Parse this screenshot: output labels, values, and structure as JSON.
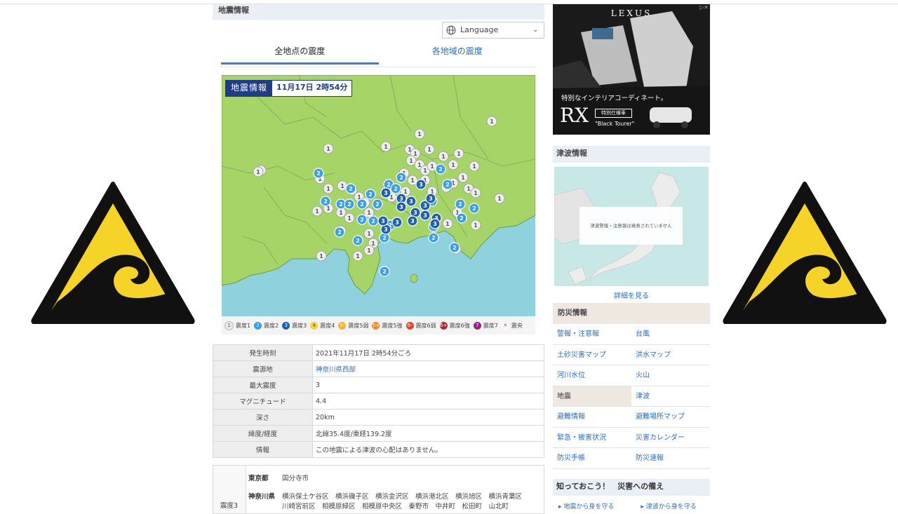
{
  "section_title": "地震情報",
  "language_label": "Language",
  "tabs": [
    "全地点の震度",
    "各地域の震度"
  ],
  "map": {
    "badge_label": "地震情報",
    "badge_datetime": "11月17日 2時54分"
  },
  "legend": [
    {
      "mark": "1",
      "label": "震度1",
      "color": "#e8e8e8",
      "text_color": "#555"
    },
    {
      "mark": "2",
      "label": "震度2",
      "color": "#3a9ee8",
      "text_color": "#fff"
    },
    {
      "mark": "3",
      "label": "震度3",
      "color": "#1f5fb0",
      "text_color": "#fff"
    },
    {
      "mark": "4",
      "label": "震度4",
      "color": "#f3d33a",
      "text_color": "#555"
    },
    {
      "mark": "5-",
      "label": "震度5弱",
      "color": "#f4b23a",
      "text_color": "#fff"
    },
    {
      "mark": "5+",
      "label": "震度5強",
      "color": "#f08a2a",
      "text_color": "#fff"
    },
    {
      "mark": "6-",
      "label": "震度6弱",
      "color": "#e2452f",
      "text_color": "#fff"
    },
    {
      "mark": "6+",
      "label": "震度6強",
      "color": "#b52034",
      "text_color": "#fff"
    },
    {
      "mark": "7",
      "label": "震度7",
      "color": "#9a1f86",
      "text_color": "#fff"
    },
    {
      "mark": "✕",
      "label": "震央",
      "color": "#ffffff",
      "text_color": "#d33"
    }
  ],
  "details": [
    {
      "key": "発生時刻",
      "value": "2021年11月17日 2時54分ごろ",
      "link": false
    },
    {
      "key": "震源地",
      "value": "神奈川県西部",
      "link": true
    },
    {
      "key": "最大震度",
      "value": "3",
      "link": false
    },
    {
      "key": "マグニチュード",
      "value": "4.4",
      "link": false
    },
    {
      "key": "深さ",
      "value": "20km",
      "link": false
    },
    {
      "key": "緯度/経度",
      "value": "北緯35.4度/東経139.2度",
      "link": false
    },
    {
      "key": "情報",
      "value": "この地震による津波の心配はありません。",
      "link": false
    }
  ],
  "intensity_table": {
    "level": "震度3",
    "rows": [
      {
        "pref": "東京都",
        "cities": "国分寺市"
      },
      {
        "pref": "神奈川県",
        "cities": "横浜保土ケ谷区　横浜磯子区　横浜金沢区　横浜港北区　横浜旭区　横浜青葉区"
      },
      {
        "pref": "",
        "cities": "川崎宮前区　相模原緑区　相模原中央区　秦野市　中井町　松田町　山北町"
      }
    ]
  },
  "ad": {
    "brand": "LEXUS",
    "close_mark": "▷✕",
    "tagline": "特別なインテリアコーディネート。",
    "model": "RX",
    "spec": "特別仕様車",
    "edition": "\"Black Tourer\""
  },
  "tsunami": {
    "title": "津波情報",
    "note": "津波警報・注意報は発表されていません",
    "more_link": "詳細を見る"
  },
  "bousai": {
    "title": "防災情報",
    "items": [
      "警報・注意報",
      "台風",
      "土砂災害マップ",
      "洪水マップ",
      "河川水位",
      "火山",
      "地震",
      "津波",
      "避難情報",
      "避難場所マップ",
      "緊急・被害状況",
      "災害カレンダー",
      "防災手帳",
      "防災速報"
    ],
    "current": "地震"
  },
  "know": {
    "title": "知っておこう！　災害への備え",
    "links": [
      "▸ 地震から身を守る",
      "▸ 津波から身を守る"
    ]
  }
}
